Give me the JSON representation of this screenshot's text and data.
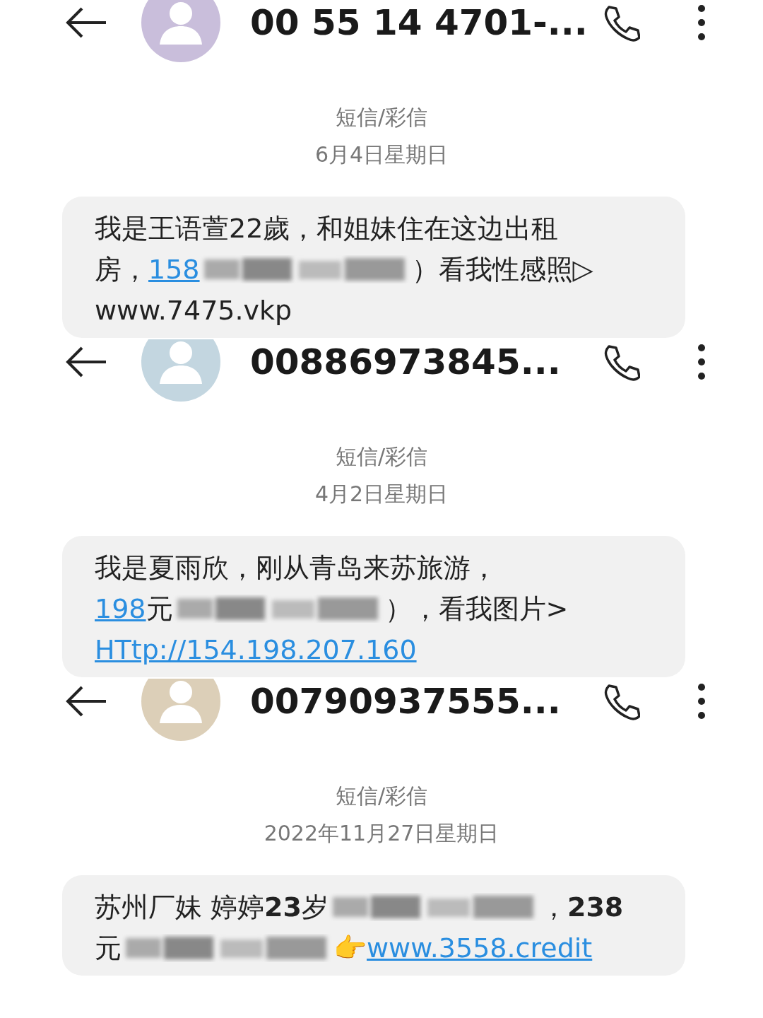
{
  "panels": [
    {
      "contact": "00 55 14 4701-...",
      "color": "#c9bedb",
      "type_label": "短信/彩信",
      "date": "6月4日星期日",
      "lines": [
        [
          {
            "kind": "text",
            "text": "我是王语萱22歲，和姐妹住在这边出租"
          }
        ],
        [
          {
            "kind": "text",
            "text": "房，"
          },
          {
            "kind": "link",
            "text": "158"
          },
          {
            "kind": "blur"
          },
          {
            "kind": "text",
            "text": "）看我性感照▷"
          }
        ],
        [
          {
            "kind": "text",
            "text": "www.7475.vkp"
          }
        ]
      ]
    },
    {
      "contact": "00886973845...",
      "color": "#c3d6e0",
      "type_label": "短信/彩信",
      "date": "4月2日星期日",
      "lines": [
        [
          {
            "kind": "text",
            "text": "我是夏雨欣，刚从青岛来苏旅游，"
          }
        ],
        [
          {
            "kind": "link",
            "text": "198"
          },
          {
            "kind": "text",
            "text": "元"
          },
          {
            "kind": "blur"
          },
          {
            "kind": "text",
            "text": "），看我图片>"
          }
        ],
        [
          {
            "kind": "link",
            "text": "HTtp://154.198.207.160"
          }
        ]
      ]
    },
    {
      "contact": "00790937555...",
      "color": "#dccfb8",
      "type_label": "短信/彩信",
      "date": "2022年11月27日星期日",
      "lines": [
        [
          {
            "kind": "text",
            "text": "苏州厂妹 婷婷 "
          },
          {
            "kind": "bold",
            "text": "23"
          },
          {
            "kind": "text",
            "text": "岁"
          },
          {
            "kind": "blur"
          },
          {
            "kind": "text",
            "text": "，"
          },
          {
            "kind": "bold",
            "text": "238"
          }
        ],
        [
          {
            "kind": "text",
            "text": "元"
          },
          {
            "kind": "blur"
          },
          {
            "kind": "text",
            "text": "👉 "
          },
          {
            "kind": "link",
            "text": "www.3558.credit"
          }
        ]
      ]
    }
  ]
}
